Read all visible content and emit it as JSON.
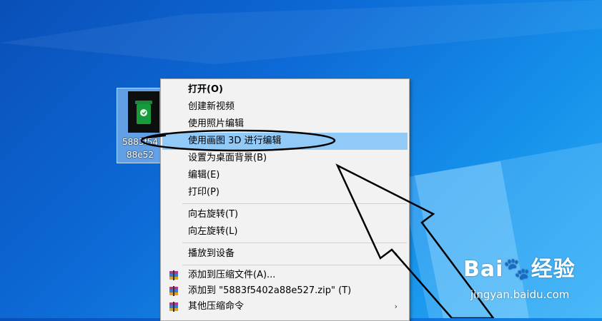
{
  "desktop_icon": {
    "label_line1": "5883f54",
    "label_line2": "88e52"
  },
  "context_menu": {
    "items": [
      {
        "label": "打开(O)"
      },
      {
        "label": "创建新视频"
      },
      {
        "label": "使用照片编辑"
      },
      {
        "label": "使用画图 3D 进行编辑"
      },
      {
        "label": "设置为桌面背景(B)"
      },
      {
        "label": "编辑(E)"
      },
      {
        "label": "打印(P)"
      },
      {
        "label": "向右旋转(T)"
      },
      {
        "label": "向左旋转(L)"
      },
      {
        "label": "播放到设备"
      },
      {
        "label": "添加到压缩文件(A)..."
      },
      {
        "label": "添加到 \"5883f5402a88e527.zip\" (T)"
      },
      {
        "label": "其他压缩命令"
      }
    ]
  },
  "watermark": {
    "brand": "Bai",
    "brand2": "经验",
    "url": "jingyan.baidu.com"
  }
}
